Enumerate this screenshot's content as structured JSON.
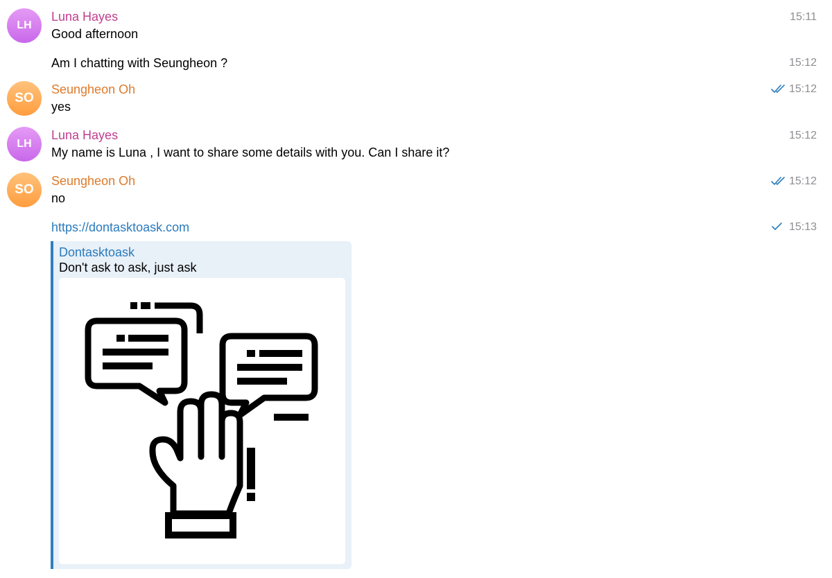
{
  "colors": {
    "luna_name": "#c03e8f",
    "seungheon_name": "#de7a2a",
    "link": "#2a7bbd",
    "time": "#8e8e93",
    "read_check": "#2a7bbd",
    "preview_bar": "#2f7ec2",
    "preview_bg": "#e8f0f8"
  },
  "messages": [
    {
      "avatar": "LH",
      "sender": "Luna Hayes",
      "text": "Good afternoon",
      "time": "15:11"
    },
    {
      "text": "Am I chatting with Seungheon ?",
      "time": "15:12"
    },
    {
      "avatar": "SO",
      "sender": "Seungheon Oh",
      "text": "yes",
      "time": "15:12",
      "status_icon": "double-check-icon"
    },
    {
      "avatar": "LH",
      "sender": "Luna Hayes",
      "text": "My name is Luna , I want to share some details with you. Can I share it?",
      "time": "15:12"
    },
    {
      "avatar": "SO",
      "sender": "Seungheon Oh",
      "text": "no",
      "time": "15:12",
      "status_icon": "double-check-icon"
    },
    {
      "text": "https://dontasktoask.com",
      "time": "15:13",
      "status_icon": "single-check-icon"
    }
  ],
  "link_preview": {
    "site_name": "Dontasktoask",
    "title": "Don't ask to ask, just ask",
    "image_icon": "chat-bubbles-raised-hand-icon"
  }
}
